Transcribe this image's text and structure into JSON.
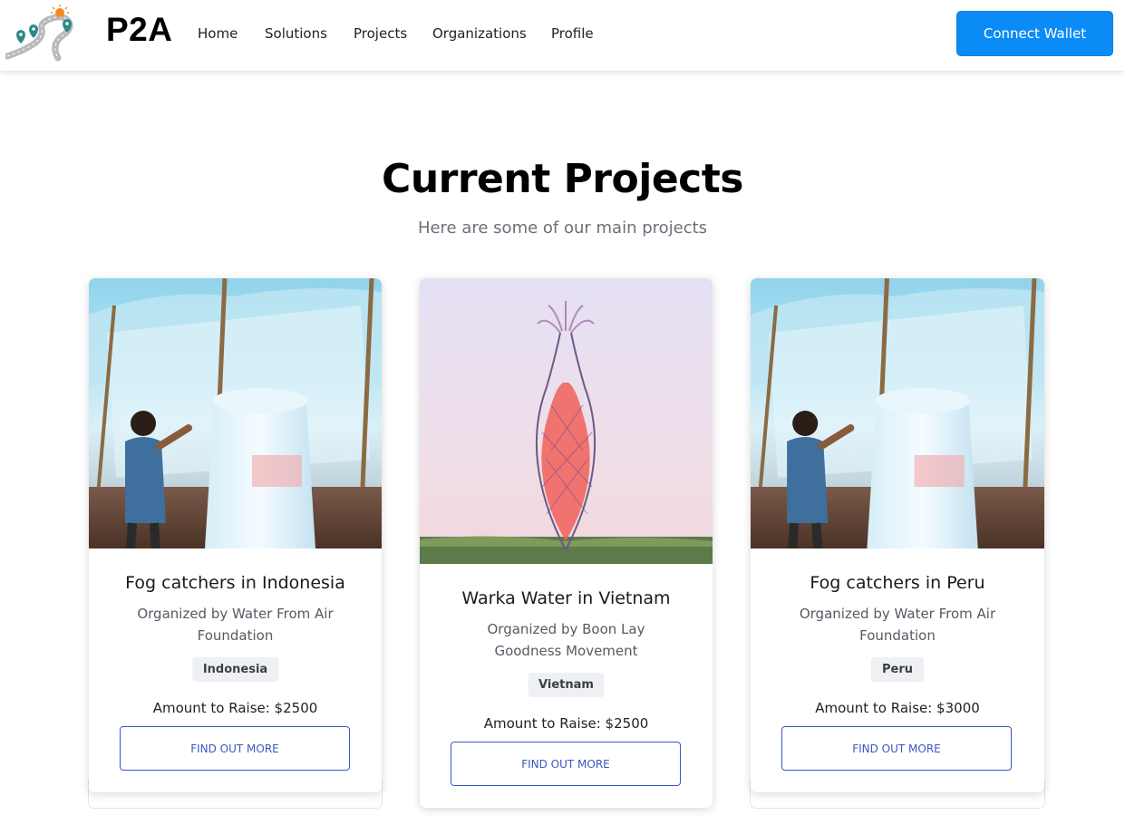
{
  "header": {
    "brand": "P2A",
    "nav": [
      "Home",
      "Solutions",
      "Projects",
      "Organizations",
      "Profile"
    ],
    "connect_label": "Connect Wallet"
  },
  "hero": {
    "title": "Current Projects",
    "subtitle": "Here are some of our main projects"
  },
  "projects": [
    {
      "title": "Fog catchers in Indonesia",
      "organizer": "Organized by Water From Air Foundation",
      "country": "Indonesia",
      "amount": "Amount to Raise: $2500",
      "button": "FIND OUT MORE",
      "image": "fog-catcher-photo"
    },
    {
      "title": "Warka Water in Vietnam",
      "organizer": "Organized by Boon Lay Goodness Movement",
      "country": "Vietnam",
      "amount": "Amount to Raise: $2500",
      "button": "FIND OUT MORE",
      "image": "warka-tower-photo"
    },
    {
      "title": "Fog catchers in Peru",
      "organizer": "Organized by Water From Air Foundation",
      "country": "Peru",
      "amount": "Amount to Raise: $3000",
      "button": "FIND OUT MORE",
      "image": "fog-catcher-photo"
    }
  ],
  "colors": {
    "accent": "#0b8bf5",
    "button_outline": "#3b57c4",
    "subtitle": "#6b6f78"
  }
}
